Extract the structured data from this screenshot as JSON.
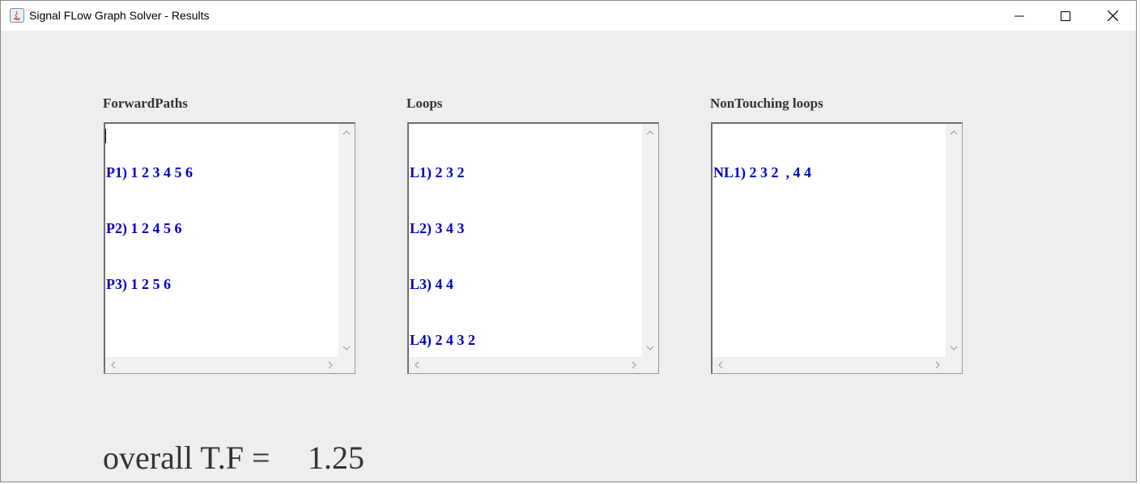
{
  "window": {
    "title": "Signal FLow Graph Solver - Results"
  },
  "sections": {
    "forward_paths": {
      "label": "ForwardPaths",
      "items": [
        "P1) 1 2 3 4 5 6",
        "P2) 1 2 4 5 6",
        "P3) 1 2 5 6"
      ]
    },
    "loops": {
      "label": "Loops",
      "items": [
        "L1) 2 3 2",
        "L2) 3 4 3",
        "L3) 4 4",
        "L4) 2 4 3 2"
      ]
    },
    "non_touching": {
      "label": "NonTouching loops",
      "items": [
        "NL1) 2 3 2  , 4 4"
      ]
    }
  },
  "result": {
    "label": "overall T.F =",
    "value": "1.25"
  },
  "colors": {
    "list_text": "#0000cc",
    "window_bg": "#eeeeee"
  }
}
